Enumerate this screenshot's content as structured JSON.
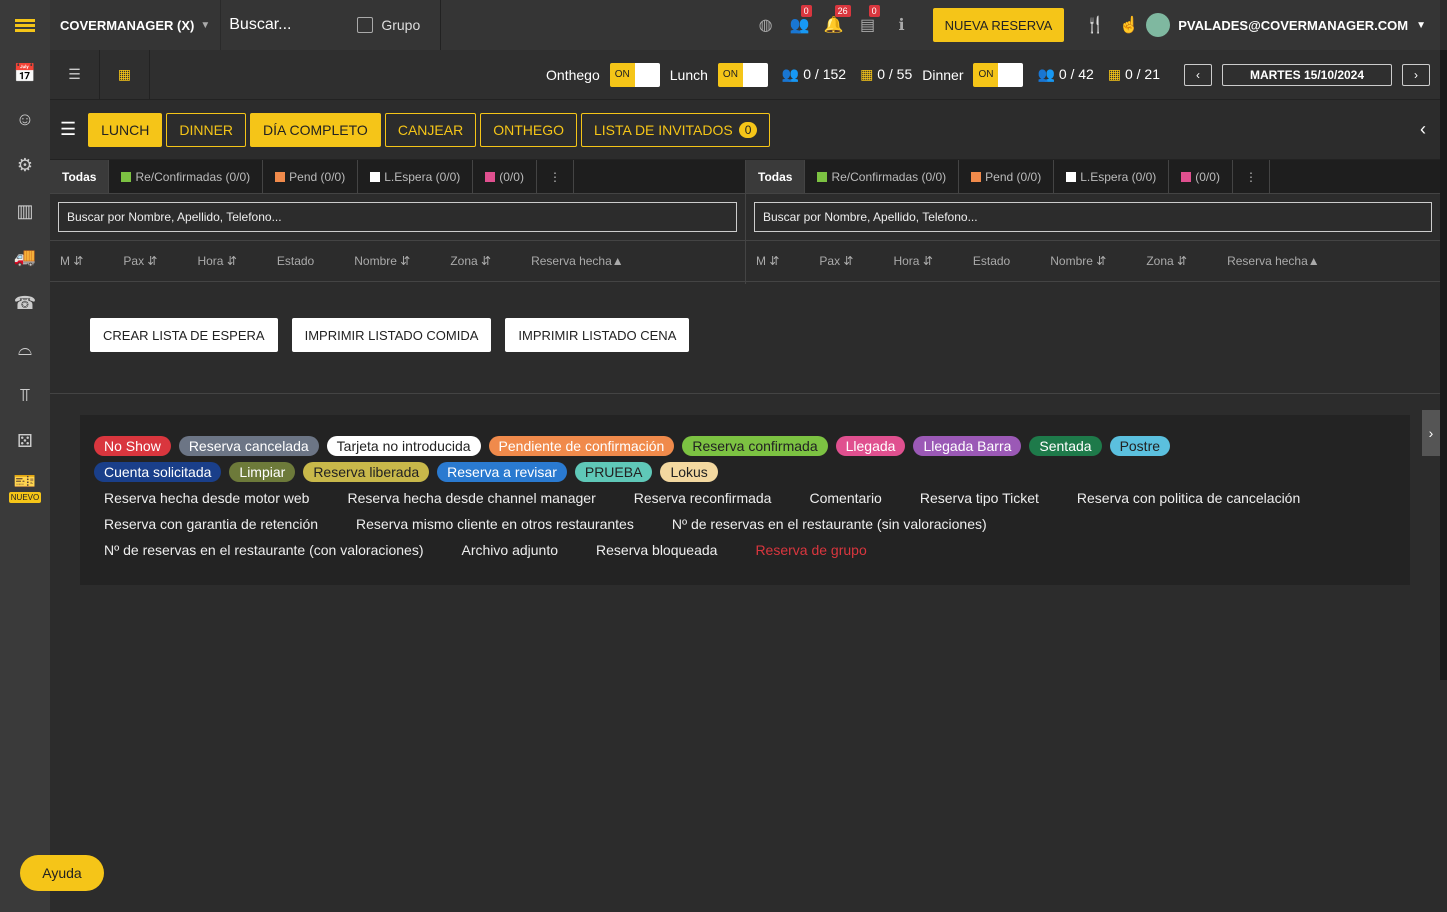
{
  "top": {
    "brand": "COVERMANAGER (X)",
    "search": "Buscar...",
    "group_label": "Grupo",
    "new_booking": "NUEVA RESERVA",
    "user": "PVALADES@COVERMANAGER.COM",
    "badges": [
      "0",
      "26",
      "0"
    ]
  },
  "sub": {
    "onthego": "Onthego",
    "lunch": "Lunch",
    "dinner": "Dinner",
    "on": "ON",
    "lunch_pax": "0 / 152",
    "lunch_tables": "0 / 55",
    "dinner_pax": "0 / 42",
    "dinner_tables": "0 / 21",
    "date": "MARTES 15/10/2024"
  },
  "filters": [
    "LUNCH",
    "DINNER",
    "DÍA COMPLETO",
    "CANJEAR",
    "ONTHEGO",
    "LISTA DE INVITADOS"
  ],
  "guest_count": "0",
  "panel": {
    "tabs": [
      "Todas",
      "Re/Confirmadas (0/0)",
      "Pend (0/0)",
      "L.Espera (0/0)",
      "(0/0)",
      "⋮"
    ],
    "search": "Buscar por Nombre, Apellido, Telefono...",
    "cols": [
      "M ⇵",
      "Pax ⇵",
      "Hora ⇵",
      "Estado",
      "Nombre ⇵",
      "Zona ⇵",
      "Reserva hecha▲"
    ]
  },
  "actions": [
    "CREAR LISTA DE ESPERA",
    "IMPRIMIR LISTADO COMIDA",
    "IMPRIMIR LISTADO CENA"
  ],
  "legend_pills": [
    "No Show",
    "Reserva cancelada",
    "Tarjeta no introducida",
    "Pendiente de confirmación",
    "Reserva confirmada",
    "Llegada",
    "Llegada Barra",
    "Sentada",
    "Postre",
    "Cuenta solicitada",
    "Limpiar",
    "Reserva liberada",
    "Reserva a revisar",
    "PRUEBA",
    "Lokus"
  ],
  "legend_items": [
    "Reserva hecha desde motor web",
    "Reserva hecha desde channel manager",
    "Reserva reconfirmada",
    "Comentario",
    "Reserva tipo Ticket",
    "Reserva con politica de cancelación",
    "Reserva con garantia de retención",
    "Reserva mismo cliente en otros restaurantes",
    "Nº de reservas en el restaurante (sin valoraciones)",
    "Nº de reservas en el restaurante (con valoraciones)",
    "Archivo adjunto",
    "Reserva bloqueada",
    "Reserva de grupo"
  ],
  "sidebar": {
    "nuevo": "NUEVO"
  },
  "help": "Ayuda"
}
